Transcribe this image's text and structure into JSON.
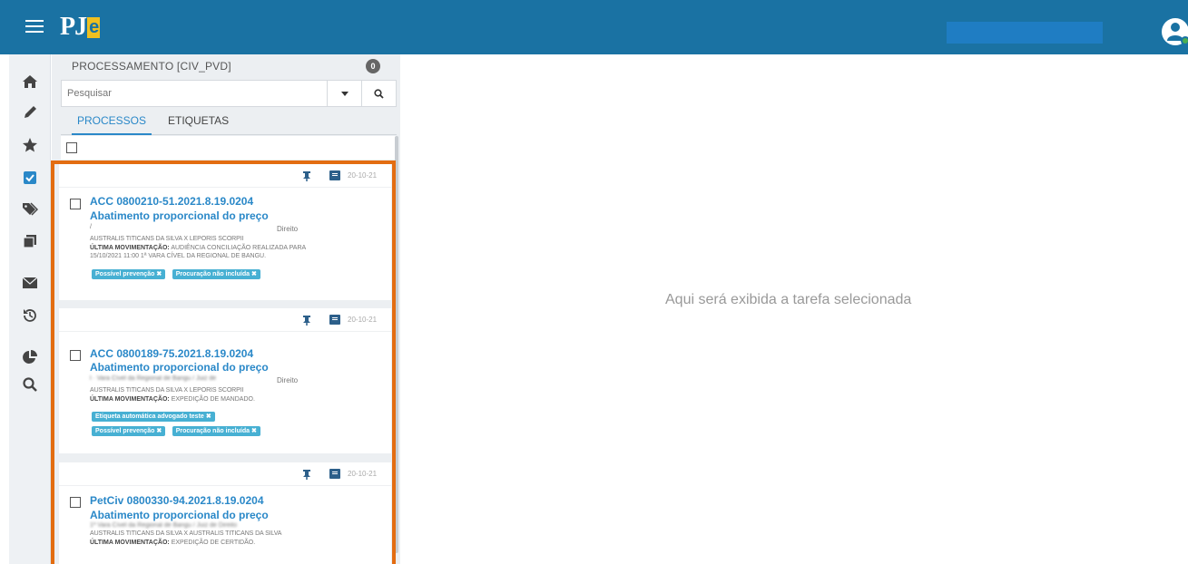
{
  "app": {
    "logo_text": "PJ",
    "logo_accent": "e"
  },
  "sidebar": {
    "items": [
      {
        "name": "home-icon"
      },
      {
        "name": "pencil-icon"
      },
      {
        "name": "star-icon"
      },
      {
        "name": "checkbox-icon"
      },
      {
        "name": "tags-icon"
      },
      {
        "name": "copy-icon"
      },
      {
        "name": "envelope-icon"
      },
      {
        "name": "history-icon"
      },
      {
        "name": "pie-chart-icon"
      },
      {
        "name": "search-icon"
      }
    ]
  },
  "panel": {
    "title": "PROCESSAMENTO [CIV_PVD]",
    "count": "0",
    "search_placeholder": "Pesquisar",
    "tabs": [
      "PROCESSOS",
      "ETIQUETAS"
    ]
  },
  "cards": [
    {
      "date": "20-10-21",
      "number": "ACC 0800210-51.2021.8.19.0204",
      "classe": "Abatimento proporcional do preço",
      "line_blur": "/",
      "court_suffix": "Direito",
      "parties": "AUSTRALIS TITICANS DA SILVA X LEPORIS SCORPII",
      "mov_label": "ÚLTIMA MOVIMENTAÇÃO:",
      "mov_text": "AUDIÊNCIA CONCILIAÇÃO REALIZADA PARA",
      "mov_text2": "15/10/2021 11:00 1ª VARA CÍVEL DA REGIONAL DE BANGU.",
      "tags_row1": [
        {
          "label": "Possível prevenção"
        },
        {
          "label": "Procuração não incluída"
        }
      ],
      "tags_row2": []
    },
    {
      "date": "20-10-21",
      "number": "ACC 0800189-75.2021.8.19.0204",
      "classe": "Abatimento proporcional do preço",
      "line_blur": "l · Vara Cível da Regional de Bangu / Juiz de",
      "court_suffix": "Direito",
      "parties": "AUSTRALIS TITICANS DA SILVA X LEPORIS SCORPII",
      "mov_label": "ÚLTIMA MOVIMENTAÇÃO:",
      "mov_text": "EXPEDIÇÃO DE MANDADO.",
      "mov_text2": "",
      "tags_row1": [
        {
          "label": "Etiqueta automática advogado teste"
        }
      ],
      "tags_row2": [
        {
          "label": "Possível prevenção"
        },
        {
          "label": "Procuração não incluída"
        }
      ]
    },
    {
      "date": "20-10-21",
      "number": "PetCiv 0800330-94.2021.8.19.0204",
      "classe": "Abatimento proporcional do preço",
      "line_blur": "1ª Vara Cível da Regional de Bangu / Juiz de Direito",
      "court_suffix": "",
      "parties": "AUSTRALIS TITICANS DA SILVA X AUSTRALIS TITICANS DA SILVA",
      "mov_label": "ÚLTIMA MOVIMENTAÇÃO:",
      "mov_text": "EXPEDIÇÃO DE CERTIDÃO.",
      "mov_text2": "",
      "tags_row1": [],
      "tags_row2": []
    }
  ],
  "main": {
    "placeholder": "Aqui será exibida a tarefa selecionada"
  },
  "colors": {
    "topbar": "#1a72a3",
    "link": "#2a88c8",
    "tag": "#47b0d3",
    "highlight_frame": "#e36d12"
  }
}
